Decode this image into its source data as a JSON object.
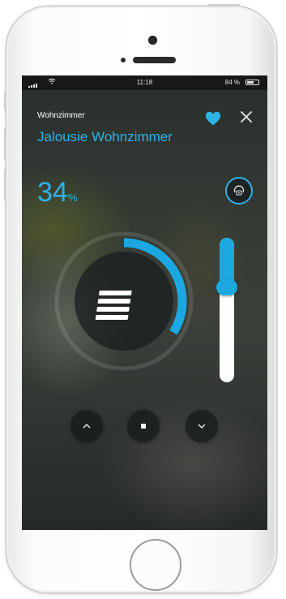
{
  "status_bar": {
    "time": "11:18",
    "battery": "84 %"
  },
  "header": {
    "room": "Wohnzimmer",
    "device": "Jalousie Wohnzimmer"
  },
  "position": {
    "value": "34",
    "unit": "%",
    "fraction": 0.34
  },
  "icons": {
    "favorite": "heart-icon",
    "close": "close-icon",
    "automation": "automation-icon",
    "blinds": "blinds-icon",
    "up": "chevron-up-icon",
    "stop": "stop-icon",
    "down": "chevron-down-icon"
  },
  "colors": {
    "accent": "#2fb2e6",
    "slider": "#1ba8e0",
    "track": "#ffffff"
  }
}
